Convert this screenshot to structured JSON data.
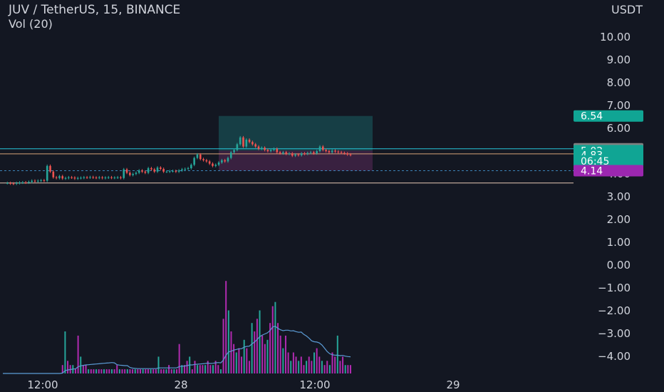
{
  "header": {
    "symbol_line": "JUV / TetherUS, 15, BINANCE",
    "volume_line": "Vol (20)"
  },
  "axis": {
    "currency": "USDT"
  },
  "colors": {
    "background": "#131722",
    "up": "#26a69a",
    "down": "#ef5350",
    "volume_up": "#26a69a",
    "volume_down": "#b02bb0",
    "ma": "#5b9bd5",
    "label_teal": "#10a594",
    "label_gray": "#808080",
    "label_purple": "#9c27b0",
    "zone_profit": "#1a5e63",
    "zone_loss": "#5a2a5a"
  },
  "chart_data": {
    "type": "candlestick",
    "title": "JUV / TetherUS, 15, BINANCE",
    "indicator": "Vol (20)",
    "y_ticks": [
      "10.00",
      "9.00",
      "8.00",
      "7.00",
      "6.00",
      "5.00",
      "4.00",
      "3.00",
      "2.00",
      "1.00",
      "0.00",
      "−1.00",
      "−2.00",
      "−3.00",
      "−4.00"
    ],
    "x_ticks": [
      "12:00",
      "28",
      "12:00",
      "29"
    ],
    "price_labels": [
      {
        "text": "6.54",
        "value": 6.54,
        "color": "teal"
      },
      {
        "text": "5.10",
        "value": 5.1,
        "color": "gray"
      },
      {
        "text": "5.02",
        "value": 5.02,
        "color": "teal"
      },
      {
        "text": "4.83",
        "value": 4.83,
        "color": "teal"
      },
      {
        "text": "06:45",
        "value": 4.57,
        "color": "teal"
      },
      {
        "text": "4.14",
        "value": 4.14,
        "color": "purple"
      }
    ],
    "horizontal_lines": [
      {
        "value": 5.1,
        "color": "#26c6da",
        "style": "solid"
      },
      {
        "value": 4.88,
        "color": "#d6a37a",
        "style": "solid"
      },
      {
        "value": 4.14,
        "color": "#3d84b8",
        "style": "dashed"
      },
      {
        "value": 3.6,
        "color": "#e6c9b5",
        "style": "solid"
      }
    ],
    "position_tool": {
      "entry": 5.02,
      "target": 6.54,
      "stop": 4.14
    },
    "price_series": [
      3.6,
      3.6,
      3.58,
      3.57,
      3.6,
      3.62,
      3.63,
      3.62,
      3.65,
      3.7,
      3.68,
      3.7,
      3.72,
      3.7,
      4.35,
      4.1,
      3.85,
      3.82,
      3.9,
      3.8,
      3.82,
      3.85,
      3.84,
      3.8,
      3.82,
      3.83,
      3.85,
      3.84,
      3.86,
      3.84,
      3.83,
      3.85,
      3.82,
      3.84,
      3.85,
      3.83,
      3.84,
      3.85,
      3.82,
      4.2,
      4.05,
      3.95,
      4.0,
      4.05,
      4.15,
      4.1,
      4.05,
      4.25,
      4.2,
      4.1,
      4.28,
      4.22,
      4.1,
      4.1,
      4.12,
      4.13,
      4.1,
      4.15,
      4.2,
      4.22,
      4.25,
      4.4,
      4.7,
      4.85,
      4.65,
      4.6,
      4.55,
      4.45,
      4.35,
      4.4,
      4.5,
      4.6,
      4.55,
      4.7,
      4.95,
      5.05,
      5.3,
      5.6,
      5.2,
      5.5,
      5.4,
      5.3,
      5.2,
      5.1,
      5.15,
      5.05,
      5.0,
      5.05,
      5.1,
      4.95,
      4.9,
      4.95,
      4.88,
      4.9,
      4.8,
      4.85,
      4.82,
      4.9,
      4.88,
      4.92,
      4.95,
      4.9,
      5.0,
      5.2,
      5.05,
      5.0,
      4.95,
      5.02,
      4.98,
      4.95,
      4.92,
      4.9,
      4.85,
      4.83
    ],
    "volume_series": [
      0,
      0,
      0,
      0,
      0,
      0,
      0,
      0,
      0,
      0,
      0,
      0,
      0,
      0,
      0,
      0,
      0,
      0,
      0,
      0,
      0,
      0,
      0,
      2,
      10,
      3,
      2,
      2,
      1,
      9,
      4,
      2,
      2,
      1,
      1,
      1,
      1,
      1,
      1,
      1,
      1,
      1,
      1,
      1,
      2,
      1,
      1,
      1,
      1,
      1,
      1,
      1,
      1,
      1,
      1,
      1,
      1,
      1,
      1,
      1,
      4,
      1,
      1,
      1,
      2,
      1,
      1,
      1,
      7,
      2,
      2,
      3,
      4,
      1,
      3,
      2,
      2,
      2,
      2,
      3,
      2,
      2,
      3,
      2,
      1,
      13,
      22,
      15,
      10,
      7,
      5,
      6,
      4,
      8,
      6,
      3,
      12,
      10,
      13,
      15,
      9,
      7,
      8,
      12,
      16,
      17,
      12,
      9,
      6,
      9,
      5,
      3,
      5,
      4,
      3,
      4,
      2,
      3,
      4,
      3,
      5,
      6,
      4,
      3,
      2,
      3,
      2,
      5,
      4,
      9,
      3,
      4,
      2,
      2,
      2
    ]
  }
}
